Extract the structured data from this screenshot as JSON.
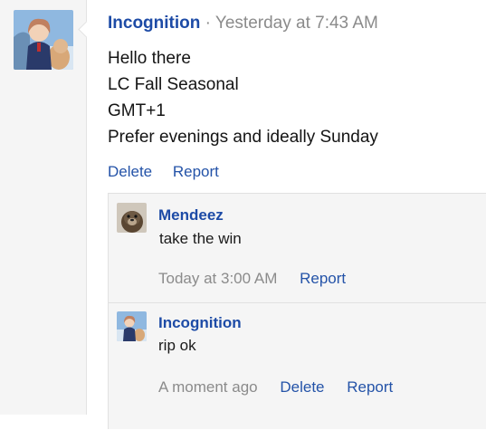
{
  "post": {
    "author": "Incognition",
    "separator": "·",
    "timestamp": "Yesterday at 7:43 AM",
    "lines": [
      "Hello there",
      "LC Fall Seasonal",
      "GMT+1",
      "Prefer evenings and ideally Sunday"
    ],
    "actions": {
      "delete": "Delete",
      "report": "Report"
    }
  },
  "replies": [
    {
      "author": "Mendeez",
      "text": "take the win",
      "time": "Today at 3:00 AM",
      "report": "Report"
    },
    {
      "author": "Incognition",
      "text": "rip ok",
      "time": "A moment ago",
      "delete": "Delete",
      "report": "Report"
    }
  ],
  "colors": {
    "link": "#2453a8",
    "username": "#1d4ba6",
    "muted": "#8b8b8b",
    "panel": "#f5f5f5"
  }
}
